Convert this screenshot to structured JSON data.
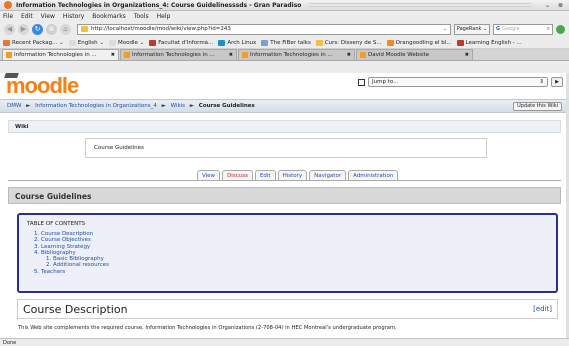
{
  "window": {
    "title": "Information Technologies in Organizations_4: Course Guidelinesssds - Gran Paradiso",
    "minimize": "⌄",
    "close": "⊗"
  },
  "menu": [
    "File",
    "Edit",
    "View",
    "History",
    "Bookmarks",
    "Tools",
    "Help"
  ],
  "nav": {
    "back": "◀",
    "forward": "▶",
    "reload": "↻",
    "stop": "⊗",
    "home": "⌂",
    "url": "http://localhost/moodle/mod/wiki/view.php?id=243",
    "url_dropdown": "⌄",
    "go_label": "PageRank ⌄",
    "search_engine": "G",
    "search_placeholder": "Google",
    "search_icon": "⌕"
  },
  "bookmarks": [
    {
      "label": "Recent Packag... ⌄",
      "color": "#e87a2e"
    },
    {
      "label": "English ⌄",
      "color": "#dcdcdc"
    },
    {
      "label": "Moodle ⌄",
      "color": "#dcdcdc"
    },
    {
      "label": "Facultat d'Informà...",
      "color": "#c0392b"
    },
    {
      "label": "Arch Linux",
      "color": "#1793d1"
    },
    {
      "label": "The FiBer talks",
      "color": "#7aa0d8"
    },
    {
      "label": "Curs: Disseny de S...",
      "color": "#f0c040"
    },
    {
      "label": "Orangoodling el bl...",
      "color": "#f08a1e"
    },
    {
      "label": "Learning English - ...",
      "color": "#c0392b"
    }
  ],
  "tabs": [
    {
      "label": "Information Technologies in ...",
      "close": "✖"
    },
    {
      "label": "Information Technologies in ...",
      "close": "✖"
    },
    {
      "label": "Information Technologies in ...",
      "close": "✖"
    },
    {
      "label": "David Moodle Website",
      "close": "✖"
    }
  ],
  "moodle": {
    "logo": "moodle",
    "jump_placeholder": "Jump to...",
    "jump_arrow": "⇕",
    "go_button": "▶",
    "breadcrumb": [
      "DMW",
      "Information Technologies in Organizations_4",
      "Wikis",
      "Course Guidelines"
    ],
    "crumb_sep": "►",
    "update_button": "Update this Wiki",
    "wiki_label": "Wiki",
    "summary": "Course Guidelines",
    "wiki_tabs": [
      "View",
      "Discuss",
      "Edit",
      "History",
      "Navigator",
      "Administration"
    ],
    "page_heading": "Course Guidelines",
    "toc": {
      "heading": "TABLE OF CONTENTS",
      "items": [
        "Course Description",
        "Course Objectives",
        "Learning Strategy",
        "Bibliography",
        "Teachers"
      ],
      "sub_items": [
        "Basic Bibliography",
        "Additional resources"
      ]
    },
    "section_heading": "Course Description",
    "edit_link": "[edit]",
    "body_text": "This Web site complements the required course, Information Technologies in Organizations (2-708-04) in HEC Montreal's undergraduate program."
  },
  "status": "Done"
}
